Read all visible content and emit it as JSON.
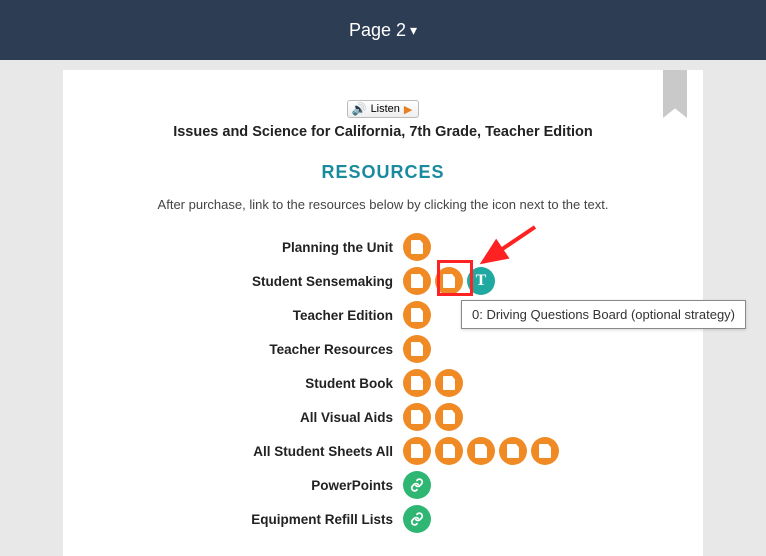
{
  "header": {
    "page_label": "Page 2"
  },
  "listen": {
    "label": "Listen"
  },
  "book_title": "Issues and Science for California, 7th Grade, Teacher Edition",
  "resources_heading": "RESOURCES",
  "instruction": "After purchase, link to the resources below by clicking the icon next to the text.",
  "rows": [
    {
      "label": "Planning the Unit",
      "icons": [
        "doc"
      ]
    },
    {
      "label": "Student Sensemaking",
      "icons": [
        "doc",
        "doc",
        "t"
      ]
    },
    {
      "label": "Teacher Edition",
      "icons": [
        "doc"
      ]
    },
    {
      "label": "Teacher Resources",
      "icons": [
        "doc"
      ]
    },
    {
      "label": "Student Book",
      "icons": [
        "doc",
        "doc"
      ]
    },
    {
      "label": "All Visual Aids",
      "icons": [
        "doc",
        "doc"
      ]
    },
    {
      "label": "All Student Sheets All",
      "icons": [
        "doc",
        "doc",
        "doc",
        "doc",
        "doc"
      ]
    },
    {
      "label": "PowerPoints",
      "icons": [
        "link"
      ]
    },
    {
      "label": "Equipment Refill Lists",
      "icons": [
        "link"
      ]
    }
  ],
  "tooltip": "0: Driving Questions Board (optional strategy)",
  "icon_t_glyph": "T"
}
